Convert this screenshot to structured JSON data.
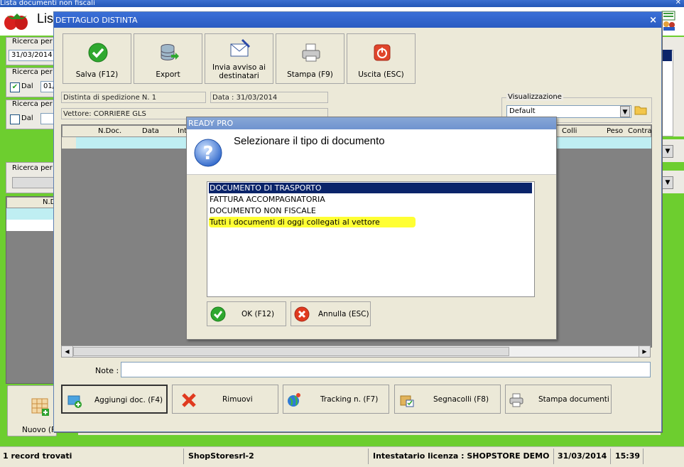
{
  "main": {
    "window_title": "Lista documenti non fiscali",
    "header_title": "Lis",
    "filters": {
      "search_label_1": "Ricerca per",
      "date_value": "31/03/2014",
      "search_label_2": "Ricerca per",
      "dal_label": "Dal",
      "dal_value": "01/",
      "search_label_3": "Ricerca per",
      "dal_label_2": "Dal",
      "search_label_4": "Ricerca per"
    },
    "grid_header": "N.D",
    "new_button": "Nuovo (F"
  },
  "dialog": {
    "title": "DETTAGLIO DISTINTA",
    "toolbar": [
      {
        "label": "Salva (F12)",
        "icon": "check-icon"
      },
      {
        "label": "Export",
        "icon": "database-export-icon"
      },
      {
        "label": "Invia avviso ai destinatari",
        "icon": "envelope-icon"
      },
      {
        "label": "Stampa (F9)",
        "icon": "printer-icon"
      },
      {
        "label": "Uscita (ESC)",
        "icon": "power-icon"
      }
    ],
    "distinta": "Distinta di spedizione N. 1",
    "data": "Data : 31/03/2014",
    "vettore": "Vettore: CORRIERE GLS",
    "visualizzazione_label": "Visualizzazione",
    "visualizzazione_value": "Default",
    "columns": [
      "N.Doc.",
      "Data",
      "Int",
      "Colli",
      "Peso",
      "Contra"
    ],
    "note_label": "Note :",
    "note_value": "",
    "bottom_buttons": [
      {
        "label": "Aggiungi doc. (F4)",
        "icon": "add-document-icon"
      },
      {
        "label": "Rimuovi",
        "icon": "remove-icon"
      },
      {
        "label": "Tracking n. (F7)",
        "icon": "globe-icon"
      },
      {
        "label": "Segnacolli (F8)",
        "icon": "package-icon"
      },
      {
        "label": "Stampa documenti",
        "icon": "printer-icon"
      }
    ]
  },
  "modal": {
    "title": "READY PRO",
    "question": "Selezionare il tipo di documento",
    "options": [
      "DOCUMENTO DI TRASPORTO",
      "FATTURA ACCOMPAGNATORIA",
      "DOCUMENTO NON FISCALE",
      "Tutti i documenti di oggi collegati al vettore"
    ],
    "ok": "OK (F12)",
    "cancel": "Annulla (ESC)"
  },
  "status": {
    "records": "1 record trovati",
    "user": "ShopStoresrl-2",
    "license": "Intestatario licenza : SHOPSTORE DEMO",
    "date": "31/03/2014",
    "time": "15:39"
  },
  "colors": {
    "selection": "#0a246a",
    "highlight": "#ffff33",
    "row_cyan": "#bfeef2",
    "background_green": "#6dce2f"
  }
}
